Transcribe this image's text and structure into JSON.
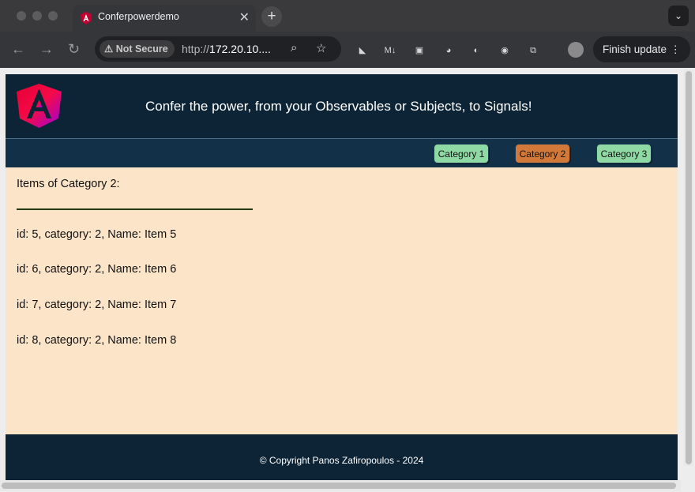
{
  "browser": {
    "tab_title": "Conferpowerdemo",
    "tab_close": "✕",
    "new_tab": "+",
    "tab_menu": "⌄",
    "security_label": "Not Secure",
    "url_scheme": "http://",
    "url_host": "172.20.10....",
    "finish_update_label": "Finish update"
  },
  "app": {
    "header_title": "Confer the power, from your Observables or Subjects, to Signals!",
    "nav": {
      "categories": [
        {
          "label": "Category 1",
          "color": "#8fd9a4",
          "active": false
        },
        {
          "label": "Category 2",
          "color": "#d2793a",
          "active": true
        },
        {
          "label": "Category 3",
          "color": "#8fd9a4",
          "active": false
        }
      ]
    },
    "items_title": "Items of Category 2:",
    "items": [
      "id: 5, category: 2, Name: Item 5",
      "id: 6, category: 2, Name: Item 6",
      "id: 7, category: 2, Name: Item 7",
      "id: 8, category: 2, Name: Item 8"
    ],
    "footer_text": "© Copyright Panos Zafiropoulos - 2024"
  },
  "colors": {
    "header_bg": "#0d2436",
    "nav_bg": "#133049",
    "content_bg": "#fbe4c8",
    "active_category": "#d2793a",
    "inactive_category": "#8fd9a4"
  }
}
